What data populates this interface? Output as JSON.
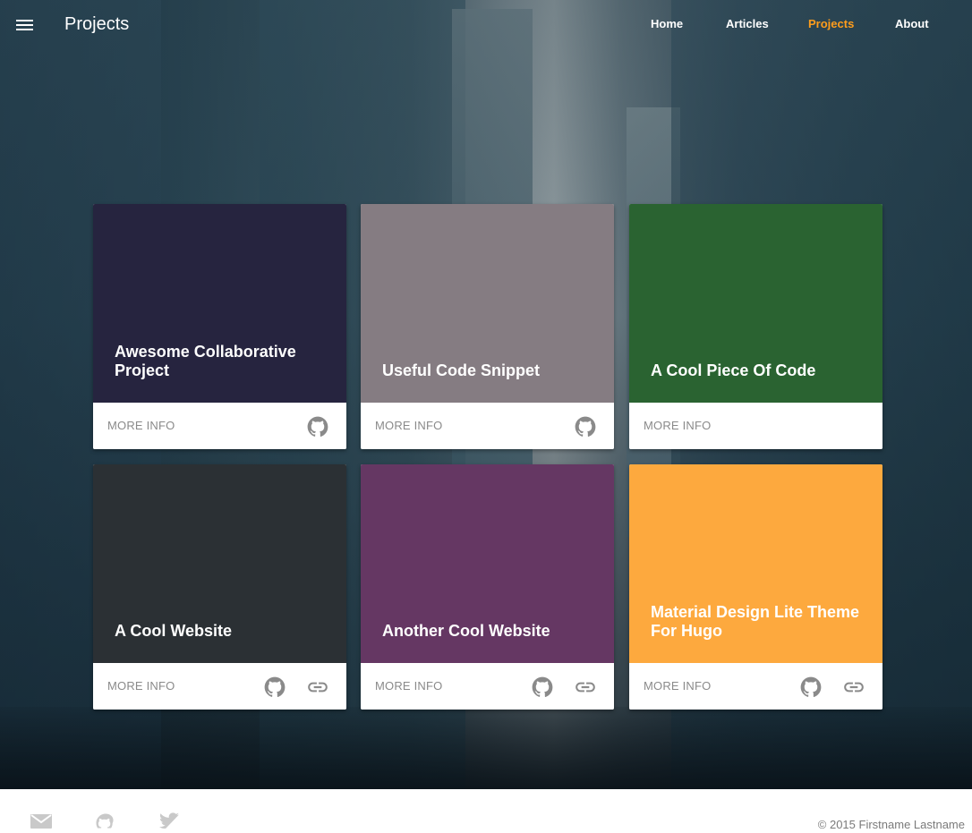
{
  "header": {
    "title": "Projects",
    "menu_icon": "menu-icon",
    "nav": [
      {
        "label": "Home",
        "active": false
      },
      {
        "label": "Articles",
        "active": false
      },
      {
        "label": "Projects",
        "active": true
      },
      {
        "label": "About",
        "active": false
      }
    ],
    "active_color": "#ff9d1c"
  },
  "cards": [
    {
      "title": "Awesome Collaborative Project",
      "color": "#26243f",
      "more_label": "MORE INFO",
      "icons": [
        "github-icon"
      ]
    },
    {
      "title": "Useful Code Snippet",
      "color": "#857c82",
      "more_label": "MORE INFO",
      "icons": [
        "github-icon"
      ]
    },
    {
      "title": "A Cool Piece Of Code",
      "color": "#2a6331",
      "more_label": "MORE INFO",
      "icons": []
    },
    {
      "title": "A Cool Website",
      "color": "#2b3034",
      "more_label": "MORE INFO",
      "icons": [
        "github-icon",
        "link-icon"
      ]
    },
    {
      "title": "Another Cool Website",
      "color": "#653763",
      "more_label": "MORE INFO",
      "icons": [
        "github-icon",
        "link-icon"
      ]
    },
    {
      "title": "Material Design Lite Theme For Hugo",
      "color": "#fda93e",
      "more_label": "MORE INFO",
      "icons": [
        "github-icon",
        "link-icon"
      ]
    }
  ],
  "footer": {
    "icons": [
      "mail-icon",
      "github-icon",
      "twitter-icon"
    ],
    "copyright": "© 2015 Firstname Lastname"
  }
}
